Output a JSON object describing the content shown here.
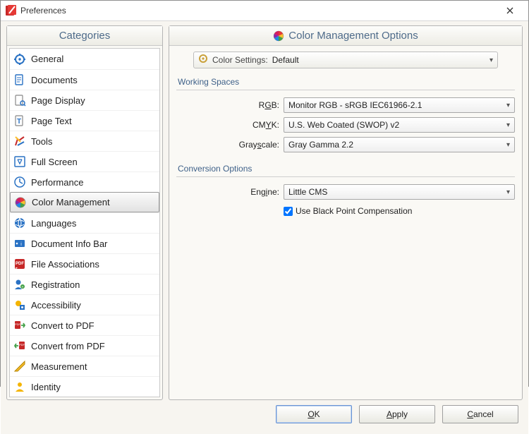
{
  "window": {
    "title": "Preferences"
  },
  "sidebar": {
    "header": "Categories",
    "items": [
      {
        "label": "General"
      },
      {
        "label": "Documents"
      },
      {
        "label": "Page Display"
      },
      {
        "label": "Page Text"
      },
      {
        "label": "Tools"
      },
      {
        "label": "Full Screen"
      },
      {
        "label": "Performance"
      },
      {
        "label": "Color Management",
        "selected": true
      },
      {
        "label": "Languages"
      },
      {
        "label": "Document Info Bar"
      },
      {
        "label": "File Associations"
      },
      {
        "label": "Registration"
      },
      {
        "label": "Accessibility"
      },
      {
        "label": "Convert to PDF"
      },
      {
        "label": "Convert from PDF"
      },
      {
        "label": "Measurement"
      },
      {
        "label": "Identity"
      }
    ]
  },
  "content": {
    "header": "Color Management Options",
    "color_settings": {
      "label": "Color Settings:",
      "value": "Default"
    },
    "groups": {
      "working_spaces": {
        "title": "Working Spaces",
        "rgb": {
          "label_pre": "R",
          "label_ul": "G",
          "label_post": "B:",
          "value": "Monitor RGB - sRGB IEC61966-2.1"
        },
        "cmyk": {
          "label_pre": "CM",
          "label_ul": "Y",
          "label_post": "K:",
          "value": "U.S. Web Coated (SWOP) v2"
        },
        "gray": {
          "label_pre": "Gray",
          "label_ul": "s",
          "label_post": "cale:",
          "value": "Gray Gamma 2.2"
        }
      },
      "conversion": {
        "title": "Conversion Options",
        "engine": {
          "label_pre": "Eng",
          "label_ul": "i",
          "label_post": "ne:",
          "value": "Little CMS"
        },
        "bpc": {
          "label_pre": "",
          "label_ul": "U",
          "label_post": "se Black Point Compensation",
          "checked": true
        }
      }
    }
  },
  "footer": {
    "ok": {
      "pre": "",
      "ul": "O",
      "post": "K"
    },
    "apply": {
      "pre": "",
      "ul": "A",
      "post": "pply"
    },
    "cancel": {
      "pre": "",
      "ul": "C",
      "post": "ancel"
    }
  }
}
